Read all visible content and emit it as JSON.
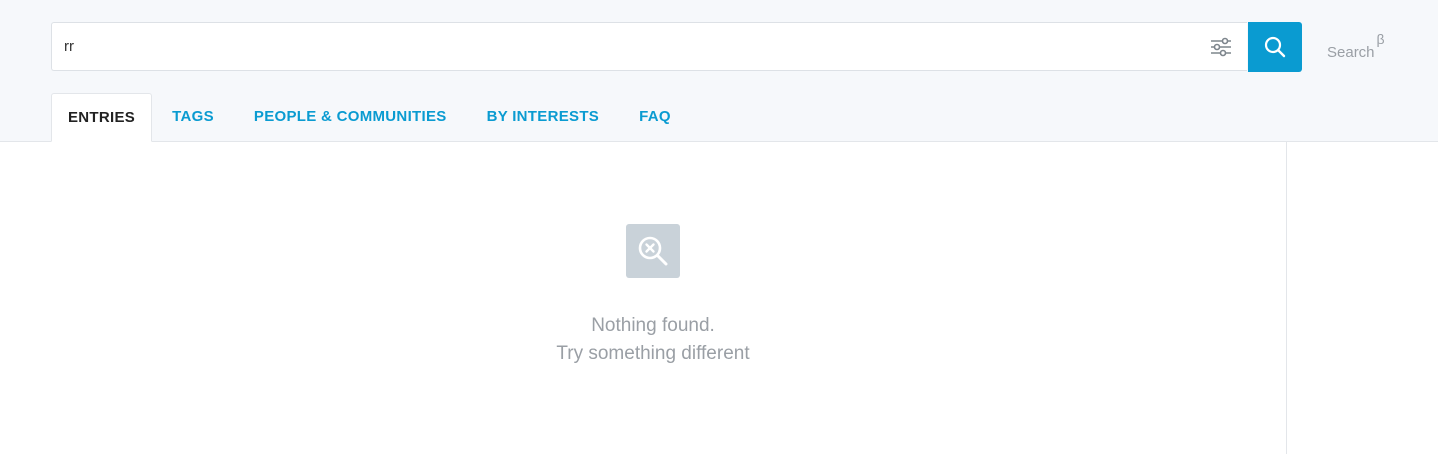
{
  "search": {
    "value": "rr",
    "filter_icon": "filter-sliders-icon",
    "button_icon": "search-icon"
  },
  "brand": {
    "label": "Search",
    "badge": "β"
  },
  "tabs": [
    {
      "label": "ENTRIES",
      "active": true
    },
    {
      "label": "TAGS",
      "active": false
    },
    {
      "label": "PEOPLE & COMMUNITIES",
      "active": false
    },
    {
      "label": "BY INTERESTS",
      "active": false
    },
    {
      "label": "FAQ",
      "active": false
    }
  ],
  "empty_state": {
    "icon": "search-not-found-icon",
    "line1": "Nothing found.",
    "line2": "Try something different"
  },
  "colors": {
    "accent": "#0a9bd1",
    "header_bg": "#f6f8fb",
    "muted_text": "#9a9fa5",
    "empty_icon_bg": "#c9d2d9"
  }
}
